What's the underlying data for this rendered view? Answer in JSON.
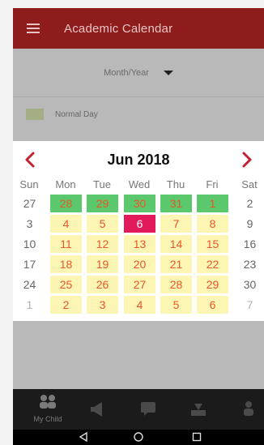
{
  "toolbar": {
    "title": "Academic Calendar"
  },
  "month_selector": {
    "value": "Month/Year"
  },
  "legend": {
    "label": "Normal Day"
  },
  "calendar": {
    "month_label": "Jun 2018",
    "weekdays": [
      "Sun",
      "Mon",
      "Tue",
      "Wed",
      "Thu",
      "Fri",
      "Sat"
    ],
    "weeks": [
      [
        {
          "d": "27",
          "t": "plain"
        },
        {
          "d": "28",
          "t": "green"
        },
        {
          "d": "29",
          "t": "green"
        },
        {
          "d": "30",
          "t": "green"
        },
        {
          "d": "31",
          "t": "green"
        },
        {
          "d": "1",
          "t": "green"
        },
        {
          "d": "2",
          "t": "plain"
        }
      ],
      [
        {
          "d": "3",
          "t": "plain"
        },
        {
          "d": "4",
          "t": "yellow"
        },
        {
          "d": "5",
          "t": "yellow"
        },
        {
          "d": "6",
          "t": "today"
        },
        {
          "d": "7",
          "t": "yellow"
        },
        {
          "d": "8",
          "t": "yellow"
        },
        {
          "d": "9",
          "t": "plain"
        }
      ],
      [
        {
          "d": "10",
          "t": "plain"
        },
        {
          "d": "11",
          "t": "yellow"
        },
        {
          "d": "12",
          "t": "yellow"
        },
        {
          "d": "13",
          "t": "yellow"
        },
        {
          "d": "14",
          "t": "yellow"
        },
        {
          "d": "15",
          "t": "yellow"
        },
        {
          "d": "16",
          "t": "plain"
        }
      ],
      [
        {
          "d": "17",
          "t": "plain"
        },
        {
          "d": "18",
          "t": "yellow"
        },
        {
          "d": "19",
          "t": "yellow"
        },
        {
          "d": "20",
          "t": "yellow"
        },
        {
          "d": "21",
          "t": "yellow"
        },
        {
          "d": "22",
          "t": "yellow"
        },
        {
          "d": "23",
          "t": "plain"
        }
      ],
      [
        {
          "d": "24",
          "t": "plain"
        },
        {
          "d": "25",
          "t": "yellow"
        },
        {
          "d": "26",
          "t": "yellow"
        },
        {
          "d": "27",
          "t": "yellow"
        },
        {
          "d": "28",
          "t": "yellow"
        },
        {
          "d": "29",
          "t": "yellow"
        },
        {
          "d": "30",
          "t": "plain"
        }
      ],
      [
        {
          "d": "1",
          "t": "muted"
        },
        {
          "d": "2",
          "t": "yellow"
        },
        {
          "d": "3",
          "t": "yellow"
        },
        {
          "d": "4",
          "t": "yellow"
        },
        {
          "d": "5",
          "t": "yellow"
        },
        {
          "d": "6",
          "t": "yellow"
        },
        {
          "d": "7",
          "t": "muted"
        }
      ]
    ]
  },
  "bottom_nav": {
    "items": [
      {
        "icon": "people-icon",
        "label": "My Child"
      },
      {
        "icon": "megaphone-icon",
        "label": ""
      },
      {
        "icon": "chat-icon",
        "label": ""
      },
      {
        "icon": "download-icon",
        "label": ""
      },
      {
        "icon": "person-icon",
        "label": ""
      }
    ]
  },
  "colors": {
    "toolbar": "#8e1c1c",
    "accent": "#c4202f",
    "event_green": "#5bc86e",
    "weekday_yellow": "#fdf5b3",
    "today_pink": "#e2195a"
  }
}
